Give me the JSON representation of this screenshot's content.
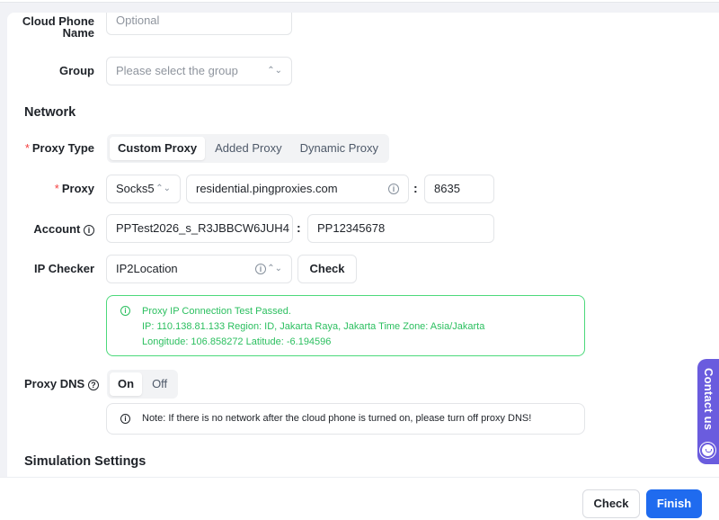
{
  "form": {
    "cloud_phone_name": {
      "label": "Cloud Phone Name",
      "placeholder": "Optional"
    },
    "group": {
      "label": "Group",
      "placeholder": "Please select the group"
    }
  },
  "network": {
    "section_title": "Network",
    "proxy_type": {
      "label": "Proxy Type",
      "required_mark": "*",
      "options": [
        "Custom Proxy",
        "Added Proxy",
        "Dynamic Proxy"
      ],
      "selected": "Custom Proxy"
    },
    "proxy": {
      "label": "Proxy",
      "required_mark": "*",
      "protocol": "Socks5",
      "host": "residential.pingproxies.com",
      "separator": ":",
      "port": "8635"
    },
    "account": {
      "label": "Account",
      "username": "PPTest2026_s_R3JBBCW6JUH4",
      "separator": ":",
      "password": "PP12345678"
    },
    "ip_checker": {
      "label": "IP Checker",
      "value": "IP2Location",
      "check_label": "Check"
    },
    "test_result": {
      "title": "Proxy IP Connection Test Passed.",
      "line2": "IP: 110.138.81.133  Region: ID, Jakarta Raya, Jakarta  Time Zone: Asia/Jakarta",
      "line3": "Longitude: 106.858272  Latitude: -6.194596"
    },
    "proxy_dns": {
      "label": "Proxy DNS",
      "options": [
        "On",
        "Off"
      ],
      "selected": "On"
    },
    "note": "Note: If there is no network after the cloud phone is turned on, please turn off proxy DNS!"
  },
  "simulation": {
    "section_title": "Simulation Settings"
  },
  "footer": {
    "check_label": "Check",
    "finish_label": "Finish"
  },
  "contact": {
    "label": "Contact us"
  },
  "colors": {
    "primary": "#1f6bef",
    "success": "#2bbf5f",
    "required": "#f53f3f",
    "contact": "#6a5cde"
  }
}
